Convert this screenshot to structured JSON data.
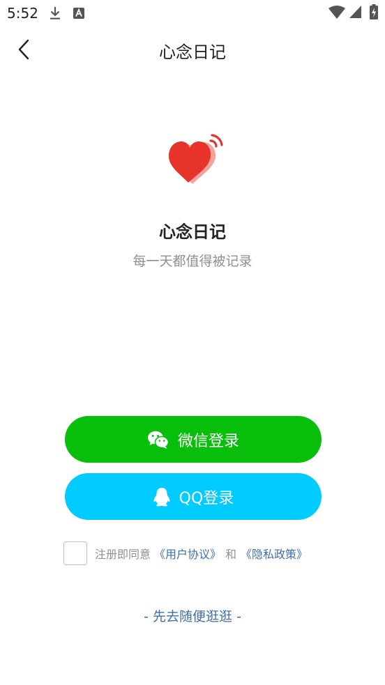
{
  "status_bar": {
    "time": "5:52"
  },
  "header": {
    "title": "心念日记"
  },
  "brand": {
    "name": "心念日记",
    "slogan": "每一天都值得被记录",
    "heart_color": "#e8332a",
    "signal_color": "#e8332a"
  },
  "login": {
    "wechat_label": "微信登录",
    "wechat_color": "#08bf0b",
    "qq_label": "QQ登录",
    "qq_color": "#00ccff"
  },
  "agreement": {
    "checked": false,
    "prefix": "注册即同意",
    "user_agreement": "《用户协议》",
    "conjunction": "和",
    "privacy_policy": "《隐私政策》"
  },
  "browse": {
    "label": "- 先去随便逛逛 -"
  }
}
